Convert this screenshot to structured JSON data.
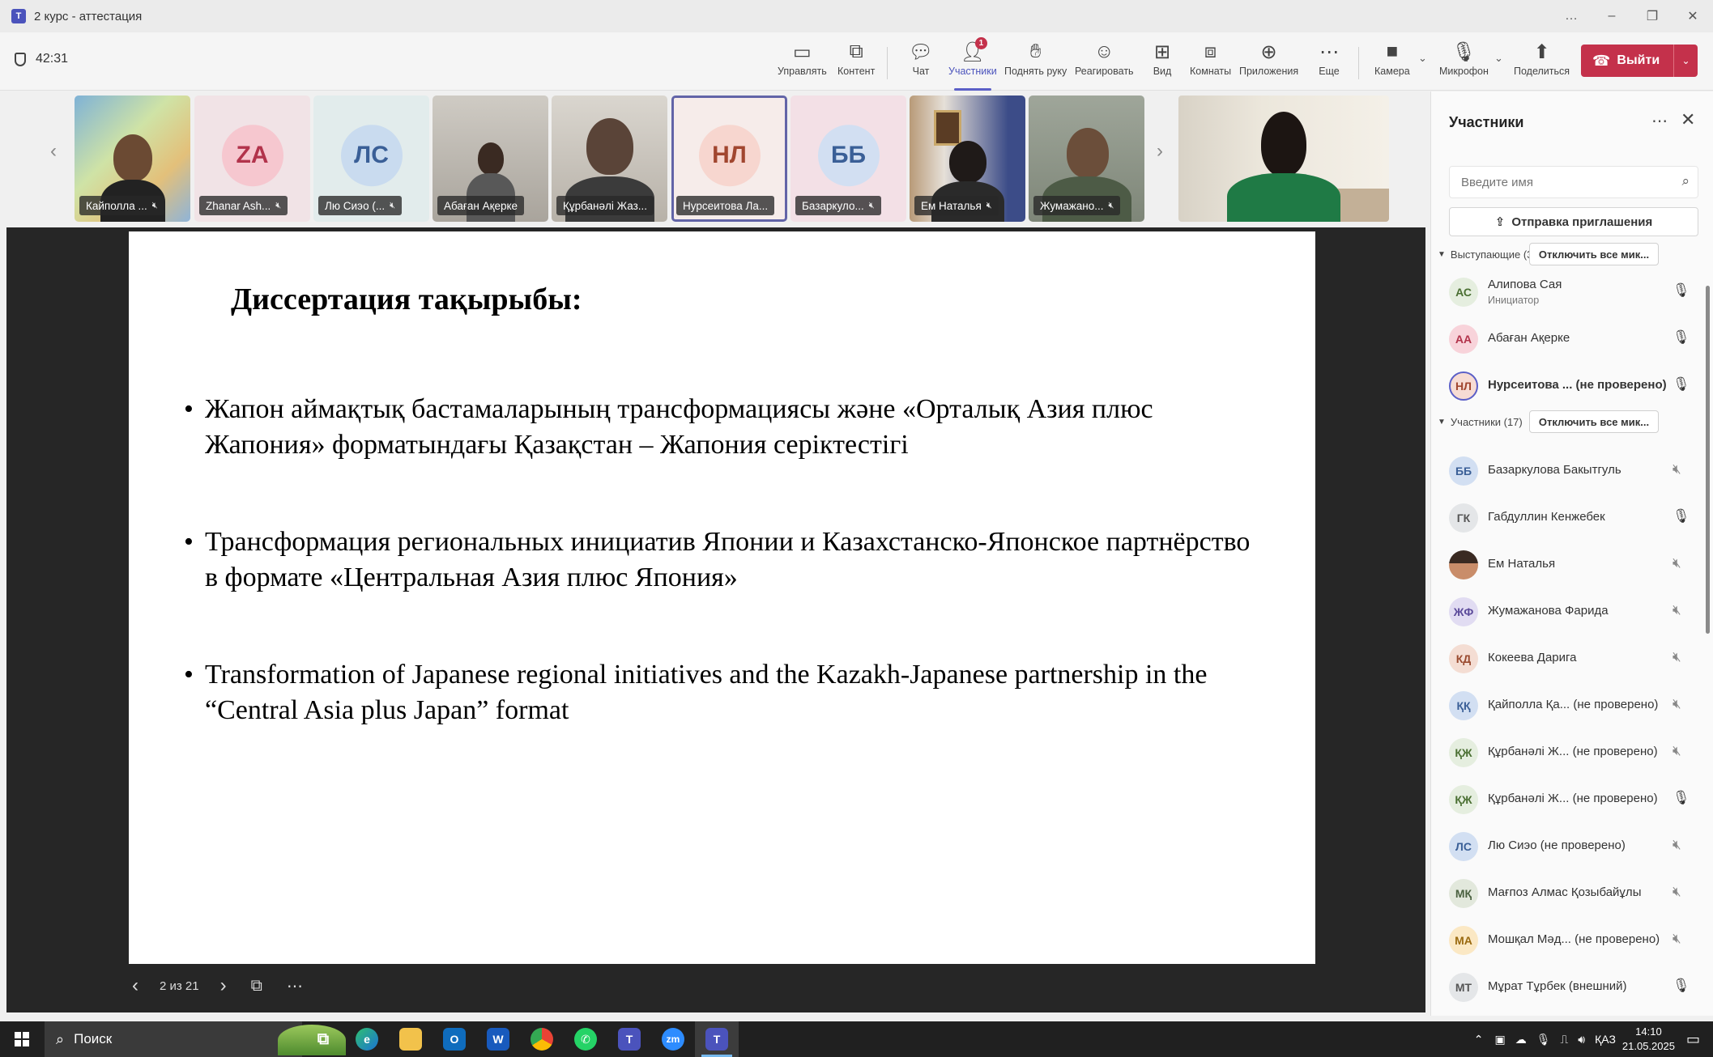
{
  "window": {
    "title": "2 курс - аттестация",
    "controls": [
      "…",
      "–",
      "❐",
      "✕"
    ]
  },
  "toolbar": {
    "timer": "42:31",
    "buttons": [
      {
        "label": "Управлять",
        "icon": "manage-icon"
      },
      {
        "label": "Контент",
        "icon": "share-content-icon"
      },
      {
        "label": "Чат",
        "icon": "chat-icon"
      },
      {
        "label": "Участники",
        "icon": "people-icon",
        "badge": "1"
      },
      {
        "label": "Поднять руку",
        "icon": "raise-hand-icon"
      },
      {
        "label": "Реагировать",
        "icon": "react-icon"
      },
      {
        "label": "Вид",
        "icon": "view-icon"
      },
      {
        "label": "Комнаты",
        "icon": "rooms-icon"
      },
      {
        "label": "Приложения",
        "icon": "apps-icon"
      },
      {
        "label": "Еще",
        "icon": "more-icon"
      },
      {
        "label": "Камера",
        "icon": "camera-icon"
      },
      {
        "label": "Микрофон",
        "icon": "microphone-icon"
      },
      {
        "label": "Поделиться",
        "icon": "share-icon"
      }
    ],
    "leave_label": "Выйти"
  },
  "video_strip": {
    "tiles": [
      {
        "name": "Кайполла ...",
        "type": "video"
      },
      {
        "name": "Zhanar Ash...",
        "initials": "ZA",
        "type": "avatar"
      },
      {
        "name": "Лю Сиэо (...",
        "initials": "ЛС",
        "type": "avatar"
      },
      {
        "name": "Абаған Ақерке",
        "type": "video"
      },
      {
        "name": "Құрбанәлі Жаз...",
        "type": "video"
      },
      {
        "name": "Нурсеитова Ла...",
        "initials": "НЛ",
        "type": "avatar",
        "selected": true
      },
      {
        "name": "Базаркуло...",
        "initials": "ББ",
        "type": "avatar"
      },
      {
        "name": "Ем Наталья",
        "type": "video"
      },
      {
        "name": "Жумажано...",
        "type": "video"
      }
    ]
  },
  "slide": {
    "title": "Диссертация тақырыбы:",
    "bullets": [
      "Жапон аймақтық бастамаларының трансформациясы және «Орталық Азия плюс Жапония» форматындағы Қазақстан – Жапония серіктестігі",
      "Трансформация региональных инициатив Японии и Казахстанско-Японское партнёрство в формате «Центральная Азия плюс Япония»",
      "Transformation of Japanese regional initiatives and the Kazakh-Japanese partnership in the “Central Asia plus Japan” format"
    ],
    "page_indicator": "2 из 21"
  },
  "participants_panel": {
    "title": "Участники",
    "search_placeholder": "Введите имя",
    "invite_label": "Отправка приглашения",
    "mute_all_label": "Отключить все мик...",
    "presenters": {
      "header": "Выступающие (3)",
      "items": [
        {
          "initials": "АС",
          "name": "Алипова Сая",
          "role": "Инициатор",
          "mic": "on"
        },
        {
          "initials": "АА",
          "name": "Абаған Ақерке",
          "mic": "on"
        },
        {
          "initials": "НЛ",
          "name": "Нурсеитова ... (не проверено)",
          "mic": "on",
          "bold": true
        }
      ]
    },
    "attendees": {
      "header": "Участники (17)",
      "items": [
        {
          "initials": "ББ",
          "name": "Базаркулова Бакытгуль",
          "mic": "off"
        },
        {
          "initials": "ГК",
          "name": "Габдуллин Кенжебек",
          "mic": "on"
        },
        {
          "initials": "",
          "name": "Ем Наталья",
          "mic": "off",
          "photo": true
        },
        {
          "initials": "ЖФ",
          "name": "Жумажанова Фарида",
          "mic": "off"
        },
        {
          "initials": "КД",
          "name": "Кокеева Дарига",
          "mic": "off"
        },
        {
          "initials": "ҚҚ",
          "name": "Қайполла Қа...  (не проверено)",
          "mic": "off"
        },
        {
          "initials": "ҚЖ",
          "name": "Құрбанәлі Ж...  (не проверено)",
          "mic": "off"
        },
        {
          "initials": "ҚЖ",
          "name": "Құрбанәлі Ж...  (не проверено)",
          "mic": "on"
        },
        {
          "initials": "ЛС",
          "name": "Лю Сиэо (не проверено)",
          "mic": "off"
        },
        {
          "initials": "МҚ",
          "name": "Мағпоз Алмас Қозыбайұлы",
          "mic": "off"
        },
        {
          "initials": "МА",
          "name": "Мошқал Мәд...  (не проверено)",
          "mic": "off"
        },
        {
          "initials": "МТ",
          "name": "Мұрат Тұрбек (внешний)",
          "mic": "on"
        }
      ]
    }
  },
  "taskbar": {
    "search_label": "Поиск",
    "language": "ҚАЗ",
    "time": "14:10",
    "date": "21.05.2025"
  },
  "colors": {
    "accent": "#5b5fc7",
    "leave": "#c4314b",
    "stage": "#262626"
  }
}
